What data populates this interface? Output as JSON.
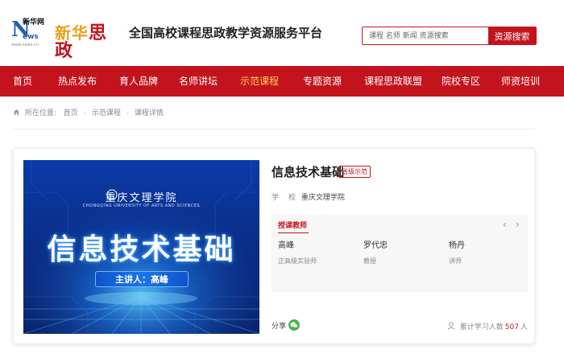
{
  "header": {
    "logo": {
      "mark": "N",
      "mark_suffix": "ews",
      "cn": "新华网",
      "url": "www.news.cn",
      "brand_left": "新华",
      "brand_right": "思政"
    },
    "site_title": "全国高校课程思政教学资源服务平台",
    "search": {
      "placeholder": "课程 名师 新闻 资源搜索",
      "button": "资源搜索"
    }
  },
  "nav": {
    "items": [
      {
        "label": "首页"
      },
      {
        "label": "热点发布"
      },
      {
        "label": "育人品牌"
      },
      {
        "label": "名师讲坛"
      },
      {
        "label": "示范课程"
      },
      {
        "label": "专题资源"
      },
      {
        "label": "课程思政联盟"
      },
      {
        "label": "院校专区"
      },
      {
        "label": "师资培训"
      }
    ],
    "active_index": 4
  },
  "breadcrumb": {
    "prefix": "所在位置:",
    "items": [
      "首页",
      "示范课程",
      "课程详情"
    ]
  },
  "course": {
    "cover": {
      "school_cn": "重庆文理学院",
      "school_en": "CHONGQING UNIVERSITY OF ARTS AND SCIENCES",
      "title": "信息技术基础",
      "speaker": "主讲人：高峰"
    },
    "title": "信息技术基础",
    "badge": "省级示范",
    "school_label": "学校",
    "school": "重庆文理学院",
    "teachers_heading": "授课教师",
    "teachers": [
      {
        "name": "高峰",
        "title": "正高级实验师"
      },
      {
        "name": "罗代忠",
        "title": "教授"
      },
      {
        "name": "杨丹",
        "title": "讲师"
      }
    ],
    "share_label": "分享",
    "learners_prefix": "累计学习人数",
    "learners_count": "507",
    "learners_suffix": "人"
  },
  "colors": {
    "brand_red": "#c3141e",
    "nav_active": "#ffd65a",
    "wechat_green": "#44b54a"
  }
}
